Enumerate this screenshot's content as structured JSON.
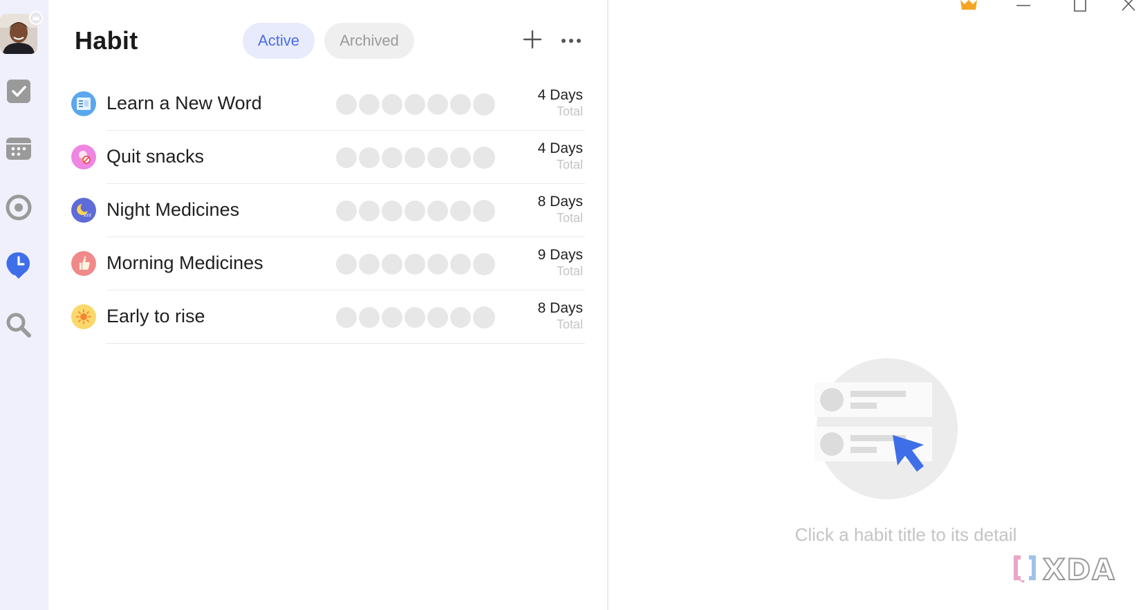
{
  "header": {
    "title": "Habit",
    "tabs": [
      {
        "label": "Active",
        "state": "selected"
      },
      {
        "label": "Archived",
        "state": "unselected"
      }
    ],
    "add_icon": "plus-icon",
    "more_icon": "more-horizontal-icon"
  },
  "sidebar": {
    "items": [
      {
        "name": "avatar",
        "icon": "user-photo"
      },
      {
        "name": "tasks",
        "icon": "checkbox-icon"
      },
      {
        "name": "calendar",
        "icon": "calendar-icon"
      },
      {
        "name": "focus",
        "icon": "target-icon"
      },
      {
        "name": "habit",
        "icon": "clock-icon",
        "active": true
      },
      {
        "name": "search",
        "icon": "search-icon"
      }
    ]
  },
  "habits": [
    {
      "name": "Learn a New Word",
      "icon": "notebook-icon",
      "icon_color": "#5aa7ee",
      "days": "4 Days",
      "label": "Total"
    },
    {
      "name": "Quit snacks",
      "icon": "no-icecream-icon",
      "icon_color": "#ee86e2",
      "days": "4 Days",
      "label": "Total"
    },
    {
      "name": "Night Medicines",
      "icon": "moon-sleep-icon",
      "icon_color": "#5e6bd8",
      "days": "8 Days",
      "label": "Total"
    },
    {
      "name": "Morning Medicines",
      "icon": "thumbs-up-icon",
      "icon_color": "#f08a8a",
      "days": "9 Days",
      "label": "Total"
    },
    {
      "name": "Early to rise",
      "icon": "sun-icon",
      "icon_color": "#fbd86b",
      "days": "8 Days",
      "label": "Total"
    }
  ],
  "detail": {
    "empty_text": "Click a habit title to its detail"
  },
  "watermark": {
    "text": "XDA"
  },
  "colors": {
    "accent": "#4a6ee0",
    "rail_bg": "#eff0fb",
    "dot": "#e7e7e7",
    "muted": "#c4c4c4"
  }
}
